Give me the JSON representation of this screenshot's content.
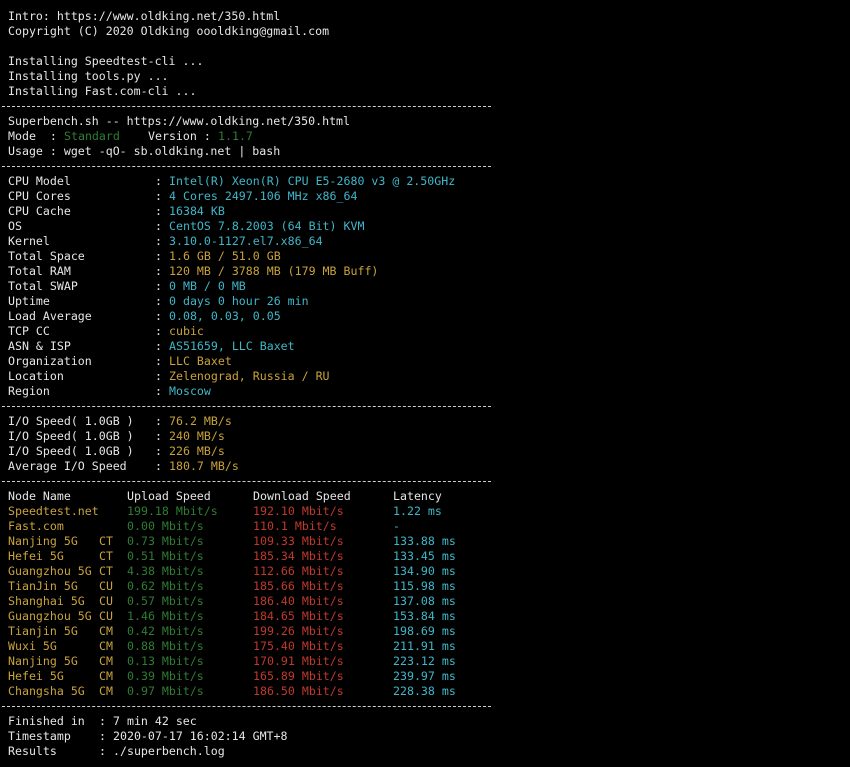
{
  "intro": [
    "Intro: https://www.oldking.net/350.html",
    "Copyright (C) 2020 Oldking oooldking@gmail.com"
  ],
  "installing": [
    "Installing Speedtest-cli ...",
    "Installing tools.py ...",
    "Installing Fast.com-cli ..."
  ],
  "header": {
    "line1": "Superbench.sh -- https://www.oldking.net/350.html",
    "mode_label": "Mode  : ",
    "mode_value": "Standard",
    "version_label": "Version : ",
    "version_value": "1.1.7",
    "usage": "Usage : wget -qO- sb.oldking.net | bash"
  },
  "sysinfo": [
    {
      "key": "CPU Model",
      "value": "Intel(R) Xeon(R) CPU E5-2680 v3 @ 2.50GHz",
      "color": "cyan"
    },
    {
      "key": "CPU Cores",
      "value": "4 Cores 2497.106 MHz x86_64",
      "color": "cyan"
    },
    {
      "key": "CPU Cache",
      "value": "16384 KB",
      "color": "cyan"
    },
    {
      "key": "OS",
      "value": "CentOS 7.8.2003 (64 Bit) KVM",
      "color": "cyan"
    },
    {
      "key": "Kernel",
      "value": "3.10.0-1127.el7.x86_64",
      "color": "cyan"
    },
    {
      "key": "Total Space",
      "value": "1.6 GB / 51.0 GB",
      "color": "orange"
    },
    {
      "key": "Total RAM",
      "value": "120 MB / 3788 MB (179 MB Buff)",
      "color": "orange"
    },
    {
      "key": "Total SWAP",
      "value": "0 MB / 0 MB",
      "color": "cyan"
    },
    {
      "key": "Uptime",
      "value": "0 days 0 hour 26 min",
      "color": "cyan"
    },
    {
      "key": "Load Average",
      "value": "0.08, 0.03, 0.05",
      "color": "cyan"
    },
    {
      "key": "TCP CC",
      "value": "cubic",
      "color": "orange"
    },
    {
      "key": "ASN & ISP",
      "value": "AS51659, LLC Baxet",
      "color": "cyan"
    },
    {
      "key": "Organization",
      "value": "LLC Baxet",
      "color": "orange"
    },
    {
      "key": "Location",
      "value": "Zelenograd, Russia / RU",
      "color": "orange"
    },
    {
      "key": "Region",
      "value": "Moscow",
      "color": "cyan"
    }
  ],
  "io": [
    {
      "key": "I/O Speed( 1.0GB )",
      "value": "76.2 MB/s"
    },
    {
      "key": "I/O Speed( 1.0GB )",
      "value": "240 MB/s"
    },
    {
      "key": "I/O Speed( 1.0GB )",
      "value": "226 MB/s"
    },
    {
      "key": "Average I/O Speed",
      "value": "180.7 MB/s"
    }
  ],
  "speed_headers": {
    "node": "Node Name",
    "upload": "Upload Speed",
    "download": "Download Speed",
    "latency": "Latency"
  },
  "speed": [
    {
      "node": "Speedtest.net",
      "isp": "",
      "up": "199.18 Mbit/s",
      "down": "192.10 Mbit/s",
      "lat": "1.22 ms"
    },
    {
      "node": "Fast.com",
      "isp": "",
      "up": "0.00 Mbit/s",
      "down": "110.1 Mbit/s",
      "lat": "-"
    },
    {
      "node": "Nanjing 5G",
      "isp": "CT",
      "up": "0.73 Mbit/s",
      "down": "109.33 Mbit/s",
      "lat": "133.88 ms"
    },
    {
      "node": "Hefei 5G",
      "isp": "CT",
      "up": "0.51 Mbit/s",
      "down": "185.34 Mbit/s",
      "lat": "133.45 ms"
    },
    {
      "node": "Guangzhou 5G",
      "isp": "CT",
      "up": "4.38 Mbit/s",
      "down": "112.66 Mbit/s",
      "lat": "134.90 ms"
    },
    {
      "node": "TianJin 5G",
      "isp": "CU",
      "up": "0.62 Mbit/s",
      "down": "185.66 Mbit/s",
      "lat": "115.98 ms"
    },
    {
      "node": "Shanghai 5G",
      "isp": "CU",
      "up": "0.57 Mbit/s",
      "down": "186.40 Mbit/s",
      "lat": "137.08 ms"
    },
    {
      "node": "Guangzhou 5G",
      "isp": "CU",
      "up": "1.46 Mbit/s",
      "down": "184.65 Mbit/s",
      "lat": "153.84 ms"
    },
    {
      "node": "Tianjin 5G",
      "isp": "CM",
      "up": "0.42 Mbit/s",
      "down": "199.26 Mbit/s",
      "lat": "198.69 ms"
    },
    {
      "node": "Wuxi 5G",
      "isp": "CM",
      "up": "0.88 Mbit/s",
      "down": "175.40 Mbit/s",
      "lat": "211.91 ms"
    },
    {
      "node": "Nanjing 5G",
      "isp": "CM",
      "up": "0.13 Mbit/s",
      "down": "170.91 Mbit/s",
      "lat": "223.12 ms"
    },
    {
      "node": "Hefei 5G",
      "isp": "CM",
      "up": "0.39 Mbit/s",
      "down": "165.89 Mbit/s",
      "lat": "239.97 ms"
    },
    {
      "node": "Changsha 5G",
      "isp": "CM",
      "up": "0.97 Mbit/s",
      "down": "186.50 Mbit/s",
      "lat": "228.38 ms"
    }
  ],
  "footer": [
    {
      "key": "Finished in",
      "value": "7 min 42 sec"
    },
    {
      "key": "Timestamp",
      "value": "2020-07-17 16:02:14 GMT+8"
    },
    {
      "key": "Results",
      "value": "./superbench.log"
    }
  ],
  "colors": {
    "background": "#000000",
    "text": "#e6e6e6",
    "cyan": "#3fb7c9",
    "orange": "#c8a23a",
    "green": "#2e7d32",
    "red": "#c0392b"
  }
}
